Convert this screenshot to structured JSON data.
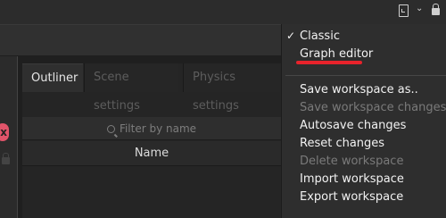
{
  "tabs": [
    {
      "label": "Outliner",
      "active": true
    },
    {
      "label": "Scene settings",
      "active": false
    },
    {
      "label": "Physics settings",
      "active": false
    }
  ],
  "filter": {
    "placeholder": "Filter by name"
  },
  "table": {
    "columns": [
      "Name"
    ]
  },
  "badge": {
    "label": "x"
  },
  "menu": {
    "layouts": [
      {
        "label": "Classic",
        "checked": true
      },
      {
        "label": "Graph editor",
        "checked": false,
        "highlighted": true
      }
    ],
    "check_mark": "✓",
    "actions": [
      {
        "label": "Save workspace as..",
        "enabled": true
      },
      {
        "label": "Save workspace changes",
        "enabled": false
      },
      {
        "label": "Autosave changes",
        "enabled": true
      },
      {
        "label": "Reset changes",
        "enabled": true
      },
      {
        "label": "Delete workspace",
        "enabled": false
      },
      {
        "label": "Import workspace",
        "enabled": true
      },
      {
        "label": "Export workspace",
        "enabled": true
      }
    ]
  },
  "colors": {
    "accent_underline": "#e8232b",
    "badge": "#e0546a"
  },
  "icons": [
    "monitor-icon",
    "chevron-down-icon",
    "padlock-icon",
    "search-icon",
    "lock-icon"
  ]
}
